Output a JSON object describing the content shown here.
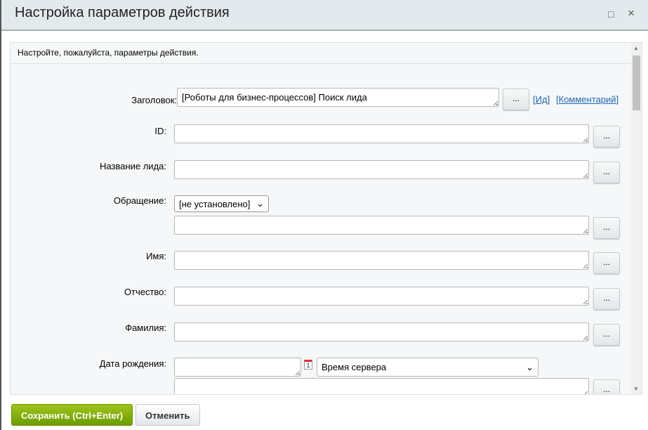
{
  "dialog": {
    "title": "Настройка параметров действия",
    "maximize_icon": "□",
    "close_icon": "×"
  },
  "intro": "Настройте, пожалуйста, параметры действия.",
  "fields": {
    "title": {
      "label": "Заголовок:",
      "value": "[Роботы для бизнес-процессов] Поиск лида",
      "id_link": "Ид",
      "comment_link": "Комментарий"
    },
    "id": {
      "label": "ID:",
      "value": ""
    },
    "lead_name": {
      "label": "Название лида:",
      "value": ""
    },
    "honorific": {
      "label": "Обращение:",
      "selected": "[не установлено]",
      "value": ""
    },
    "first_name": {
      "label": "Имя:",
      "value": ""
    },
    "middle_name": {
      "label": "Отчество:",
      "value": ""
    },
    "last_name": {
      "label": "Фамилия:",
      "value": ""
    },
    "birthdate": {
      "label": "Дата рождения:",
      "value": "",
      "calendar_icon": "1",
      "timezone": "Время сервера"
    }
  },
  "dots_label": "...",
  "footer": {
    "save": "Сохранить (Ctrl+Enter)",
    "cancel": "Отменить"
  }
}
